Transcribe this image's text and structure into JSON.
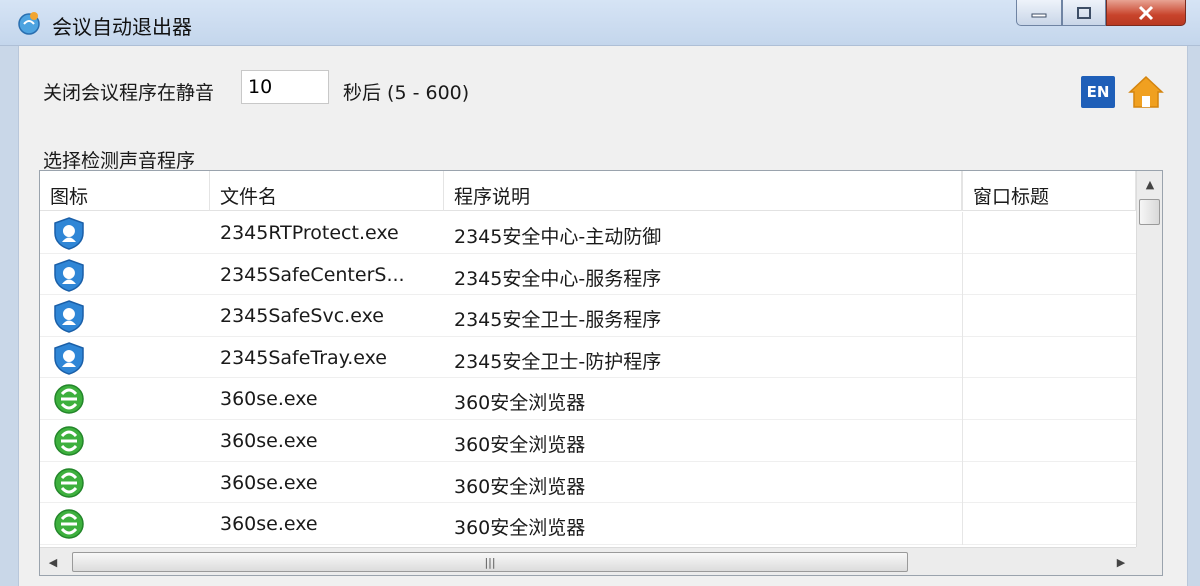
{
  "window": {
    "title": "会议自动退出器"
  },
  "settings": {
    "close_label": "关闭会议程序在静音",
    "seconds_value": "10",
    "after_label": "秒后 (5 - 600)",
    "language_button": "EN"
  },
  "list": {
    "section_label": "选择检测声音程序",
    "columns": [
      "图标",
      "文件名",
      "程序说明",
      "窗口标题"
    ],
    "rows": [
      {
        "icon": "shield-icon",
        "file": "2345RTProtect.exe",
        "desc": "2345安全中心-主动防御",
        "title": ""
      },
      {
        "icon": "shield-icon",
        "file": "2345SafeCenterS...",
        "desc": "2345安全中心-服务程序",
        "title": ""
      },
      {
        "icon": "shield-icon",
        "file": "2345SafeSvc.exe",
        "desc": "2345安全卫士-服务程序",
        "title": ""
      },
      {
        "icon": "shield-icon",
        "file": "2345SafeTray.exe",
        "desc": "2345安全卫士-防护程序",
        "title": ""
      },
      {
        "icon": "browser-icon",
        "file": "360se.exe",
        "desc": "360安全浏览器",
        "title": ""
      },
      {
        "icon": "browser-icon",
        "file": "360se.exe",
        "desc": "360安全浏览器",
        "title": ""
      },
      {
        "icon": "browser-icon",
        "file": "360se.exe",
        "desc": "360安全浏览器",
        "title": ""
      },
      {
        "icon": "browser-icon",
        "file": "360se.exe",
        "desc": "360安全浏览器",
        "title": ""
      }
    ]
  },
  "colors": {
    "titlebar": "#c9d7e8",
    "close_button": "#c8442c",
    "en_button": "#1f5fb8",
    "home_icon": "#f0a020"
  }
}
